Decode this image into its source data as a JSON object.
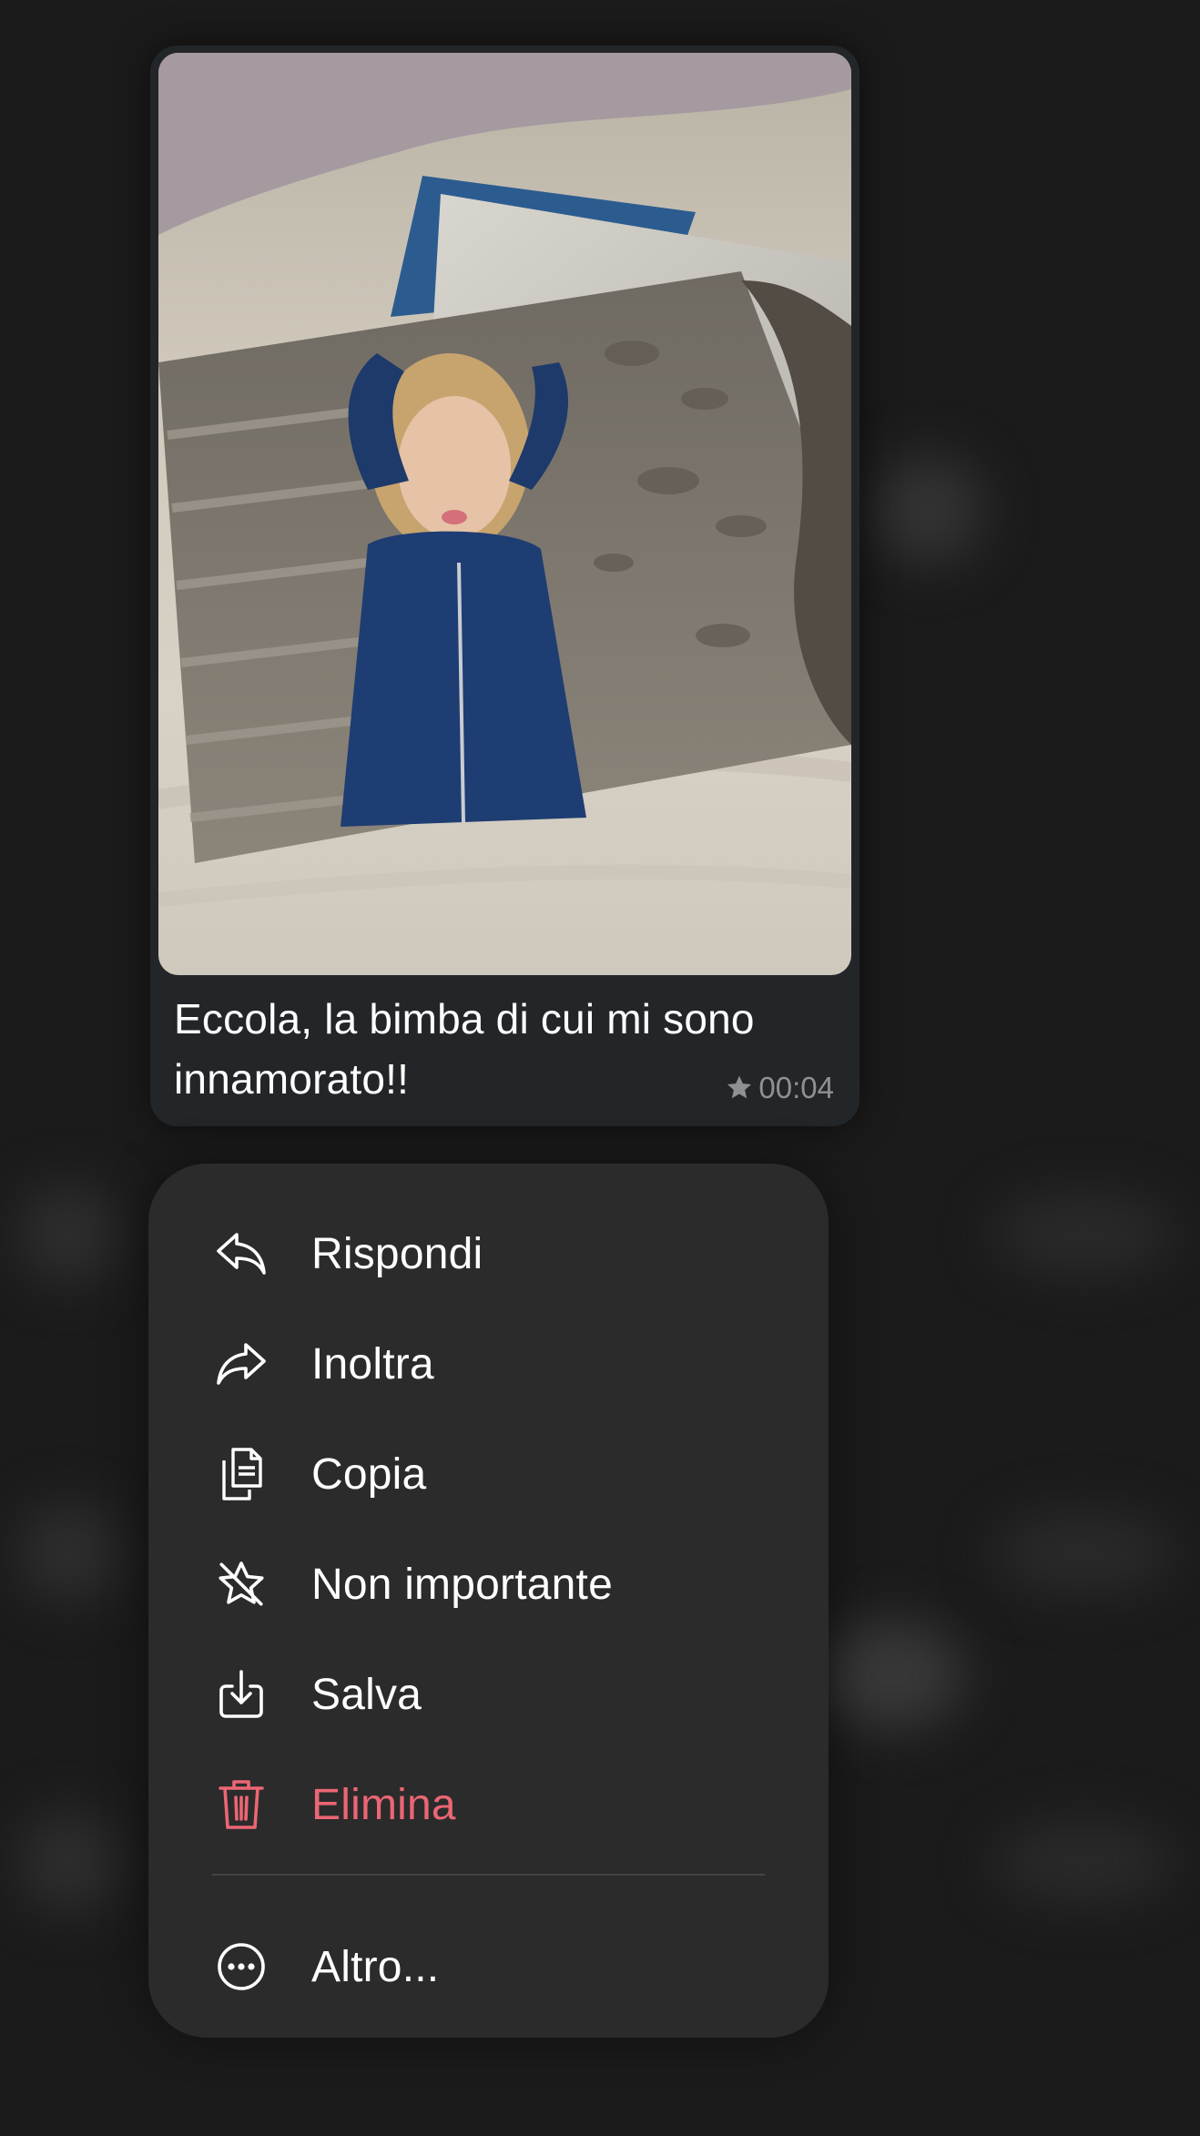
{
  "message": {
    "caption": "Eccola, la bimba di cui mi sono innamorato!!",
    "time": "00:04",
    "starred_icon": "star-icon"
  },
  "context_menu": {
    "items": [
      {
        "label": "Rispondi",
        "icon": "reply-icon"
      },
      {
        "label": "Inoltra",
        "icon": "forward-icon"
      },
      {
        "label": "Copia",
        "icon": "copy-icon"
      },
      {
        "label": "Non importante",
        "icon": "unstar-icon"
      },
      {
        "label": "Salva",
        "icon": "save-icon"
      },
      {
        "label": "Elimina",
        "icon": "trash-icon"
      }
    ],
    "more": {
      "label": "Altro...",
      "icon": "more-icon"
    }
  },
  "colors": {
    "background": "#1b1b1b",
    "bubble": "#232628",
    "menu": "#2b2b2b",
    "danger": "#eb6674"
  }
}
